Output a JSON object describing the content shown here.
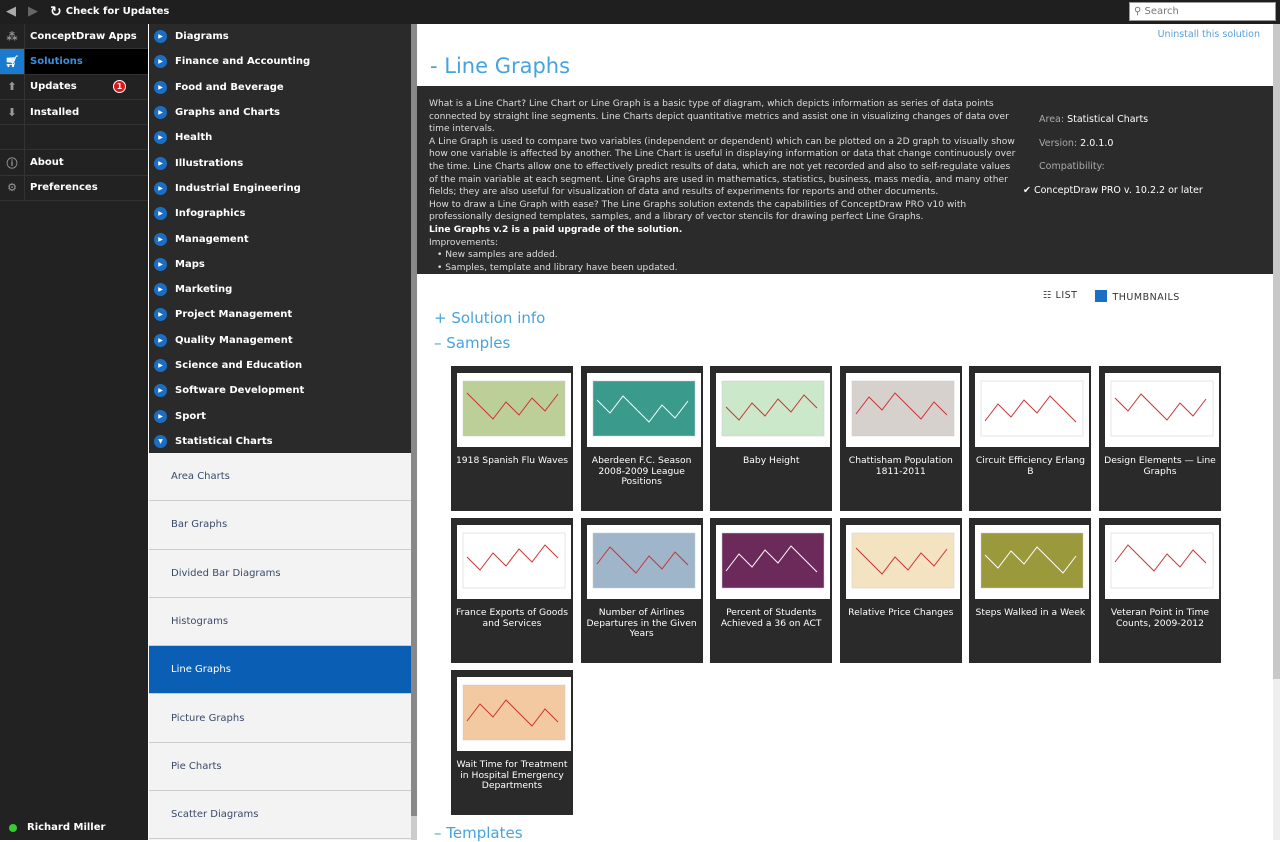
{
  "toolbar": {
    "back_icon": "back-arrow-icon",
    "forward_icon": "forward-arrow-icon",
    "check_updates": "Check for Updates",
    "search_placeholder": "Search"
  },
  "nav": {
    "items": [
      {
        "label": "ConceptDraw Apps",
        "icon": "apps-icon"
      },
      {
        "label": "Solutions",
        "icon": "cart-icon",
        "selected": true
      },
      {
        "label": "Updates",
        "icon": "updates-icon",
        "badge": "1"
      },
      {
        "label": "Installed",
        "icon": "download-icon"
      },
      {
        "label": ""
      },
      {
        "label": "About",
        "icon": "info-icon"
      },
      {
        "label": "Preferences",
        "icon": "gear-icon"
      }
    ],
    "user": "Richard Miller"
  },
  "categories": [
    "Diagrams",
    "Finance and Accounting",
    "Food and Beverage",
    "Graphs and Charts",
    "Health",
    "Illustrations",
    "Industrial Engineering",
    "Infographics",
    "Management",
    "Maps",
    "Marketing",
    "Project Management",
    "Quality Management",
    "Science and Education",
    "Software Development",
    "Sport",
    "Statistical Charts"
  ],
  "subcategories": [
    "Area Charts",
    "Bar Graphs",
    "Divided Bar Diagrams",
    "Histograms",
    "Line Graphs",
    "Picture Graphs",
    "Pie Charts",
    "Scatter Diagrams"
  ],
  "selected_subcategory": "Line Graphs",
  "main": {
    "uninstall": "Uninstall this solution",
    "title": "- Line Graphs",
    "description": [
      "What is a Line Chart? Line Chart or Line Graph is a basic type of diagram, which depicts information as series of data points connected by straight line segments. Line Charts depict quantitative metrics and assist one in visualizing changes of data over time intervals.",
      "A Line Graph is used to compare two variables (independent or dependent) which can be plotted on a 2D graph to visually show how one variable is affected by another. The Line Chart is useful in displaying information or data that change continuously over the time. Line Charts allow one to effectively predict results of data, which are not yet recorded and also to self-regulate values of the main variable at each segment. Line Graphs are used in mathematics, statistics, business, mass media, and many other fields; they are also useful for visualization of data and results of experiments for reports and other documents.",
      "How to draw a Line Graph with ease? The Line Graphs solution extends the capabilities of ConceptDraw PRO v10 with professionally designed templates, samples, and a library of vector stencils for drawing perfect Line Graphs."
    ],
    "paid_note": "Line Graphs v.2 is a paid upgrade of the solution.",
    "improvements_label": "Improvements:",
    "improvements": [
      "• New samples are added.",
      "• Samples, template and library have been updated."
    ],
    "area_label": "Area:",
    "area": "Statistical Charts",
    "version_label": "Version:",
    "version": "2.0.1.0",
    "compat_label": "Compatibility:",
    "compat": "ConceptDraw PRO v. 10.2.2 or later",
    "view_list": "LIST",
    "view_thumbnails": "THUMBNAILS",
    "solution_info": "+ Solution info",
    "samples": "– Samples",
    "templates": "– Templates"
  },
  "samples": [
    {
      "title": "1918 Spanish Flu Waves",
      "color": "#bccf98"
    },
    {
      "title": "Aberdeen F.C. Season 2008-2009 League Positions",
      "color": "#3a9a8c"
    },
    {
      "title": "Baby Height",
      "color": "#cbe8cb"
    },
    {
      "title": "Chattisham Population 1811-2011",
      "color": "#d6d1cd"
    },
    {
      "title": "Circuit Efficiency Erlang B",
      "color": "#ffffff"
    },
    {
      "title": "Design Elements — Line Graphs",
      "color": "#ffffff"
    },
    {
      "title": "France Exports of Goods and Services",
      "color": "#ffffff"
    },
    {
      "title": "Number of Airlines Departures in the Given Years",
      "color": "#9fb5c9"
    },
    {
      "title": "Percent of Students Achieved a 36 on ACT",
      "color": "#6b2a5a"
    },
    {
      "title": "Relative Price Changes",
      "color": "#f3e3c0"
    },
    {
      "title": "Steps Walked in a Week",
      "color": "#9a9a3c"
    },
    {
      "title": "Veteran Point in Time Counts, 2009-2012",
      "color": "#ffffff"
    },
    {
      "title": "Wait Time for Treatment in Hospital Emergency Departments",
      "color": "#f2c9a0"
    }
  ]
}
